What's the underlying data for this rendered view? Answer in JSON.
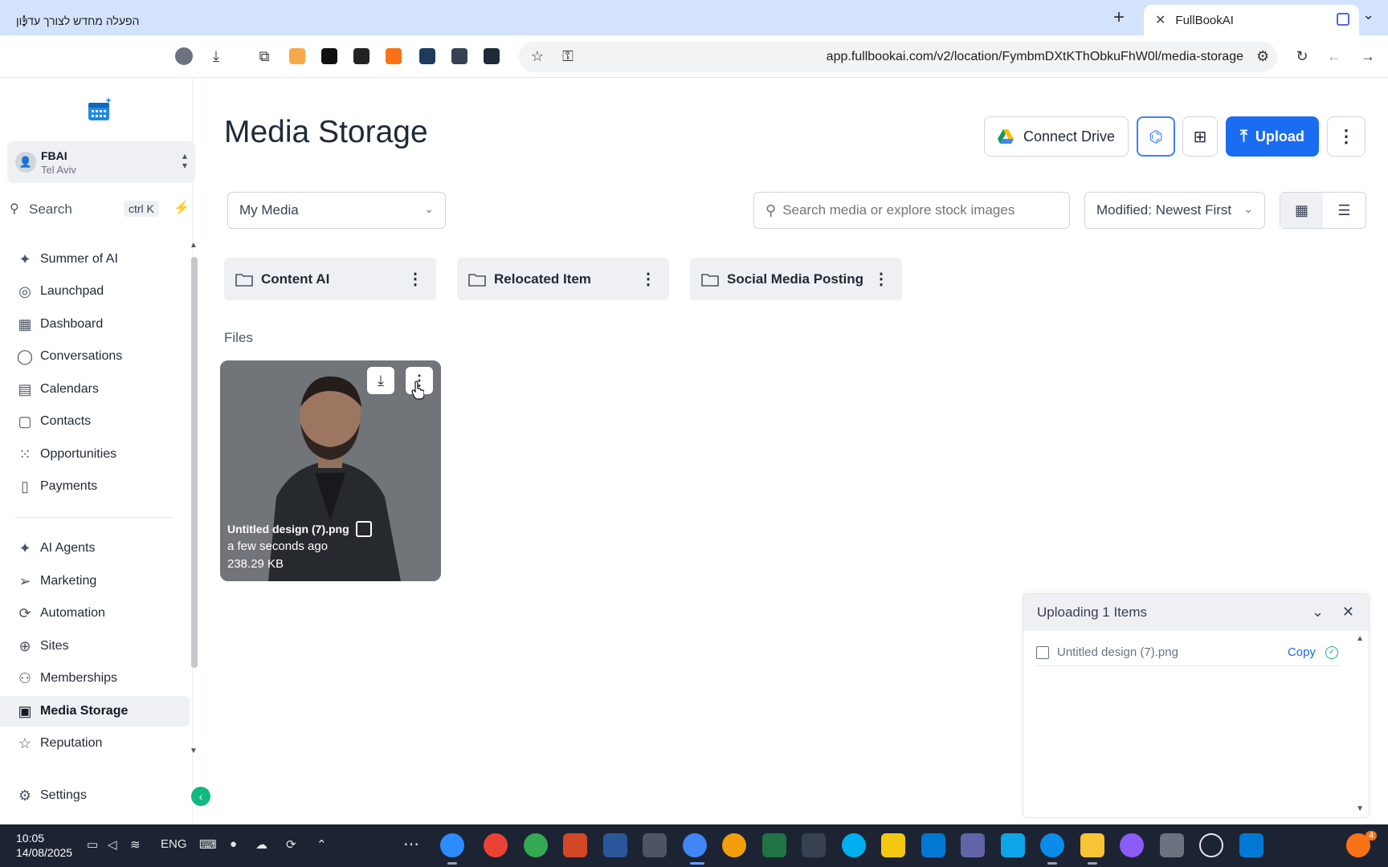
{
  "browser": {
    "tab_title": "FullBookAI",
    "url": "app.fullbookai.com/v2/location/FymbmDXtKThObkuFhW0l/media-storage",
    "update_button_label": "הפעלה מחדש לצורך עדכון"
  },
  "sidebar": {
    "account": {
      "name": "FBAI",
      "location": "Tel Aviv"
    },
    "search": {
      "label": "Search",
      "shortcut": "ctrl K"
    },
    "nav_primary": [
      {
        "label": "Summer of AI",
        "icon": "sparkle-icon"
      },
      {
        "label": "Launchpad",
        "icon": "rocket-icon"
      },
      {
        "label": "Dashboard",
        "icon": "grid-icon"
      },
      {
        "label": "Conversations",
        "icon": "chat-icon"
      },
      {
        "label": "Calendars",
        "icon": "calendar-icon"
      },
      {
        "label": "Contacts",
        "icon": "contact-icon"
      },
      {
        "label": "Opportunities",
        "icon": "funnel-icon"
      },
      {
        "label": "Payments",
        "icon": "receipt-icon"
      }
    ],
    "nav_secondary": [
      {
        "label": "AI Agents",
        "icon": "sparkle-icon"
      },
      {
        "label": "Marketing",
        "icon": "send-icon"
      },
      {
        "label": "Automation",
        "icon": "automation-icon"
      },
      {
        "label": "Sites",
        "icon": "globe-icon"
      },
      {
        "label": "Memberships",
        "icon": "badge-icon"
      },
      {
        "label": "Media Storage",
        "icon": "image-icon",
        "active": true
      },
      {
        "label": "Reputation",
        "icon": "star-icon"
      }
    ],
    "settings_label": "Settings"
  },
  "main": {
    "title": "Media Storage",
    "connect_drive_label": "Connect Drive",
    "upload_label": "Upload",
    "media_select": "My Media",
    "search_placeholder": "Search media or explore stock images",
    "sort_select": "Modified: Newest First",
    "folders": [
      {
        "name": "Content AI"
      },
      {
        "name": "Relocated Item"
      },
      {
        "name": "Social Media Posting"
      }
    ],
    "files_label": "Files",
    "files": [
      {
        "name": "Untitled design (7).png",
        "modified": "a few seconds ago",
        "size": "238.29 KB"
      }
    ]
  },
  "upload_panel": {
    "title": "Uploading 1 Items",
    "items": [
      {
        "name": "Untitled design (7).png",
        "action": "Copy"
      }
    ]
  },
  "taskbar": {
    "time": "10:05",
    "date": "14/08/2025",
    "language": "ENG",
    "notification_count": "4"
  },
  "colors": {
    "primary": "#1a6cf0",
    "accent_green": "#10b981",
    "tabbar": "#d3e3fd",
    "taskbar": "#1c2433"
  }
}
